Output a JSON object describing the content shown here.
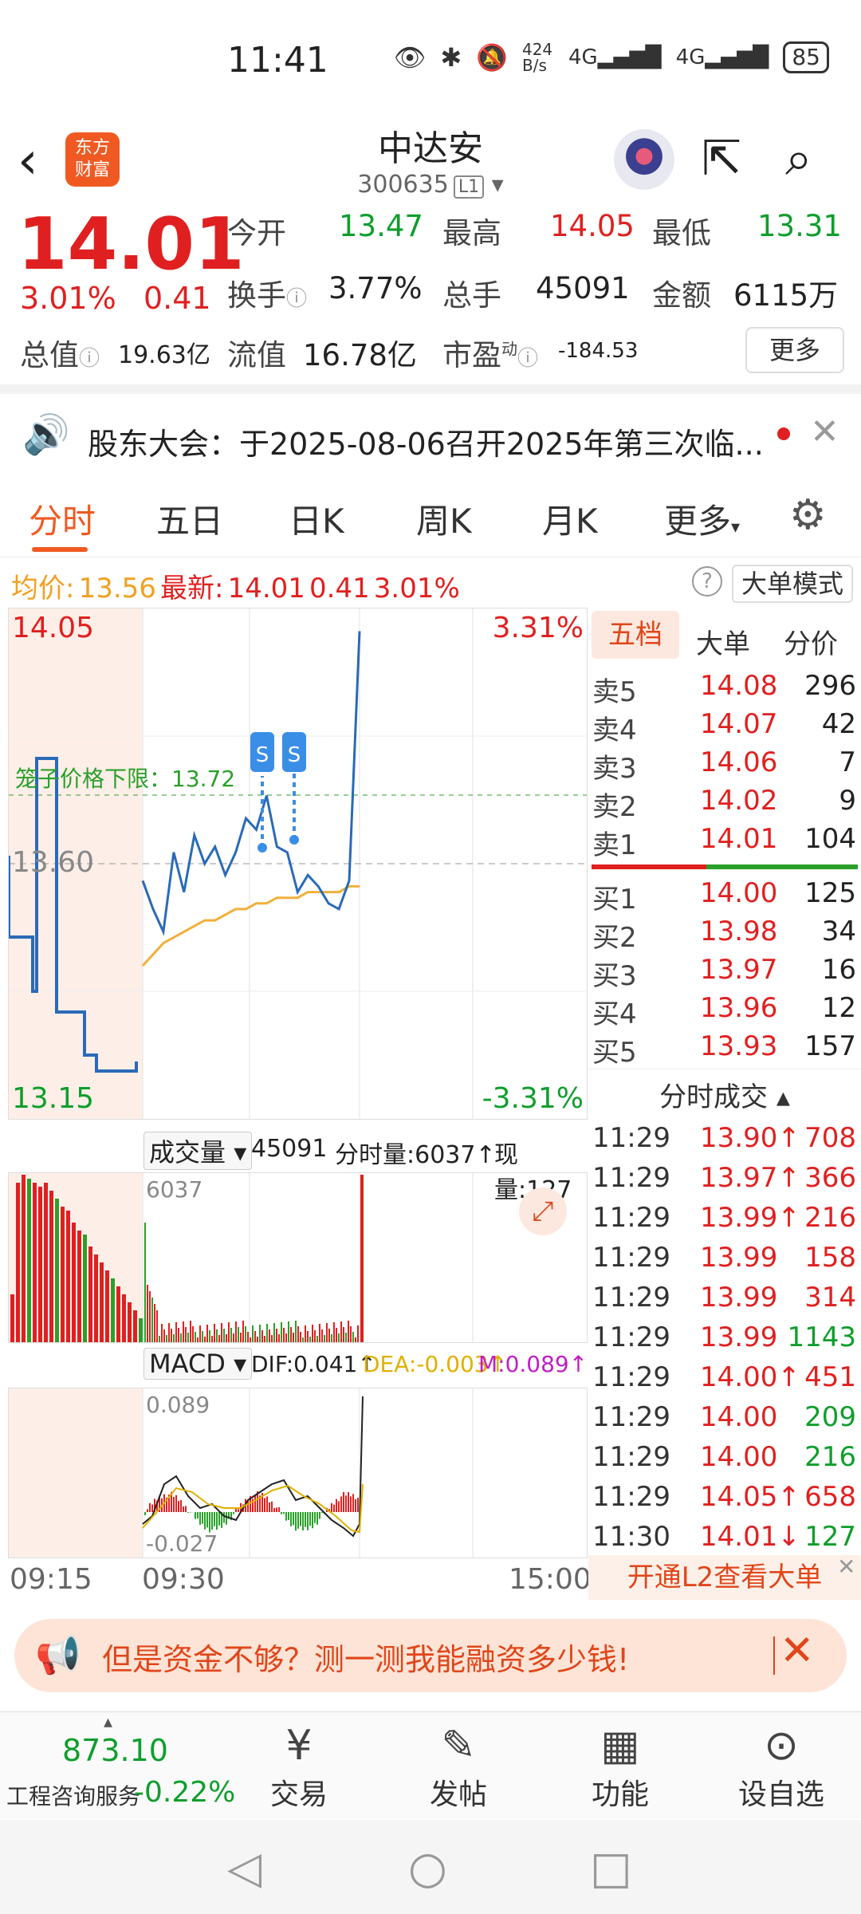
{
  "status": {
    "time": "11:41",
    "net_speed": "424 B/s",
    "signal": "4G",
    "battery": "85"
  },
  "header": {
    "name": "中达安",
    "code": "300635",
    "level": "L1",
    "logo": "东方\n财富"
  },
  "quote": {
    "price": "14.01",
    "pct": "3.01%",
    "change": "0.41",
    "open_label": "今开",
    "open": "13.47",
    "high_label": "最高",
    "high": "14.05",
    "low_label": "最低",
    "low": "13.31",
    "turnover_label": "换手",
    "turnover": "3.77%",
    "volume_label": "总手",
    "volume": "45091",
    "amount_label": "金额",
    "amount": "6115万",
    "mcap_label": "总值",
    "mcap": "19.63亿",
    "float_label": "流值",
    "float": "16.78亿",
    "pe_label": "市盈",
    "pe_sup": "动",
    "pe": "-184.53",
    "more": "更多"
  },
  "notice": {
    "text": "股东大会：于2025-08-06召开2025年第三次临..."
  },
  "tabs": [
    "分时",
    "五日",
    "日K",
    "周K",
    "月K",
    "更多"
  ],
  "avgbar": {
    "avg_label": "均价:",
    "avg": "13.56",
    "latest_label": "最新:",
    "latest": "14.01",
    "chg": "0.41",
    "pct": "3.01%",
    "mode": "大单模式"
  },
  "chart": {
    "top_price": "14.05",
    "bottom_price": "13.15",
    "top_pct": "3.31%",
    "bottom_pct": "-3.31%",
    "mid_price": "13.60",
    "cage_label": "笼子价格下限：13.72",
    "vol_label": "成交量",
    "vol_total": "45091",
    "vol_minute": "分时量:6037↑",
    "vol_now": "现量:127",
    "vol_max": "6037",
    "macd_label": "MACD",
    "dif": "DIF:0.041↑",
    "dea": "DEA:-0.003↑",
    "m": "M:0.089↑",
    "macd_max": "0.089",
    "macd_min": "-0.027",
    "t_start": "09:15",
    "t_open": "09:30",
    "t_end": "15:00",
    "colors": {
      "up": "#e02020",
      "down": "#109e2c",
      "price_line": "#2a6ab8",
      "avg_line": "#f2b03a"
    }
  },
  "chart_data": {
    "type": "line",
    "title": "",
    "x_range": [
      "09:15",
      "15:00"
    ],
    "y_range": [
      13.15,
      14.05
    ],
    "series": [
      {
        "values": [
          13.57,
          13.52,
          13.48,
          13.62,
          13.55,
          13.65,
          13.6,
          13.63,
          13.58,
          13.62,
          13.68,
          13.66,
          13.72,
          13.63,
          13.62,
          13.55,
          13.58,
          13.56,
          13.53,
          13.52,
          13.57,
          14.01
        ]
      },
      {
        "values": [
          13.42,
          13.44,
          13.46,
          13.47,
          13.48,
          13.49,
          13.5,
          13.5,
          13.51,
          13.52,
          13.52,
          13.53,
          13.53,
          13.54,
          13.54,
          13.54,
          13.55,
          13.55,
          13.55,
          13.55,
          13.56,
          13.56
        ]
      }
    ]
  },
  "book": {
    "tabs": [
      "五档",
      "大单",
      "分价"
    ],
    "sell": [
      {
        "label": "卖5",
        "price": "14.08",
        "vol": "296"
      },
      {
        "label": "卖4",
        "price": "14.07",
        "vol": "42"
      },
      {
        "label": "卖3",
        "price": "14.06",
        "vol": "7"
      },
      {
        "label": "卖2",
        "price": "14.02",
        "vol": "9"
      },
      {
        "label": "卖1",
        "price": "14.01",
        "vol": "104"
      }
    ],
    "buy": [
      {
        "label": "买1",
        "price": "14.00",
        "vol": "125"
      },
      {
        "label": "买2",
        "price": "13.98",
        "vol": "34"
      },
      {
        "label": "买3",
        "price": "13.97",
        "vol": "16"
      },
      {
        "label": "买4",
        "price": "13.96",
        "vol": "12"
      },
      {
        "label": "买5",
        "price": "13.93",
        "vol": "157"
      }
    ],
    "trades_title": "分时成交",
    "trades": [
      {
        "t": "11:29",
        "p": "13.90↑",
        "v": "708",
        "c": "red"
      },
      {
        "t": "11:29",
        "p": "13.97↑",
        "v": "366",
        "c": "red"
      },
      {
        "t": "11:29",
        "p": "13.99↑",
        "v": "216",
        "c": "red"
      },
      {
        "t": "11:29",
        "p": "13.99",
        "v": "158",
        "c": "red"
      },
      {
        "t": "11:29",
        "p": "13.99",
        "v": "314",
        "c": "red"
      },
      {
        "t": "11:29",
        "p": "13.99",
        "v": "1143",
        "c": "green"
      },
      {
        "t": "11:29",
        "p": "14.00↑",
        "v": "451",
        "c": "red"
      },
      {
        "t": "11:29",
        "p": "14.00",
        "v": "209",
        "c": "green"
      },
      {
        "t": "11:29",
        "p": "14.00",
        "v": "216",
        "c": "green"
      },
      {
        "t": "11:29",
        "p": "14.05↑",
        "v": "658",
        "c": "red"
      },
      {
        "t": "11:30",
        "p": "14.01↓",
        "v": "127",
        "c": "green"
      }
    ],
    "l2": "开通L2查看大单"
  },
  "promo": {
    "text": "但是资金不够？测一测我能融资多少钱!"
  },
  "bottom": {
    "index_value": "873.10",
    "index_name": "工程咨询服务",
    "index_chg": "-0.22%",
    "nav": [
      "交易",
      "发帖",
      "功能",
      "设自选"
    ]
  }
}
